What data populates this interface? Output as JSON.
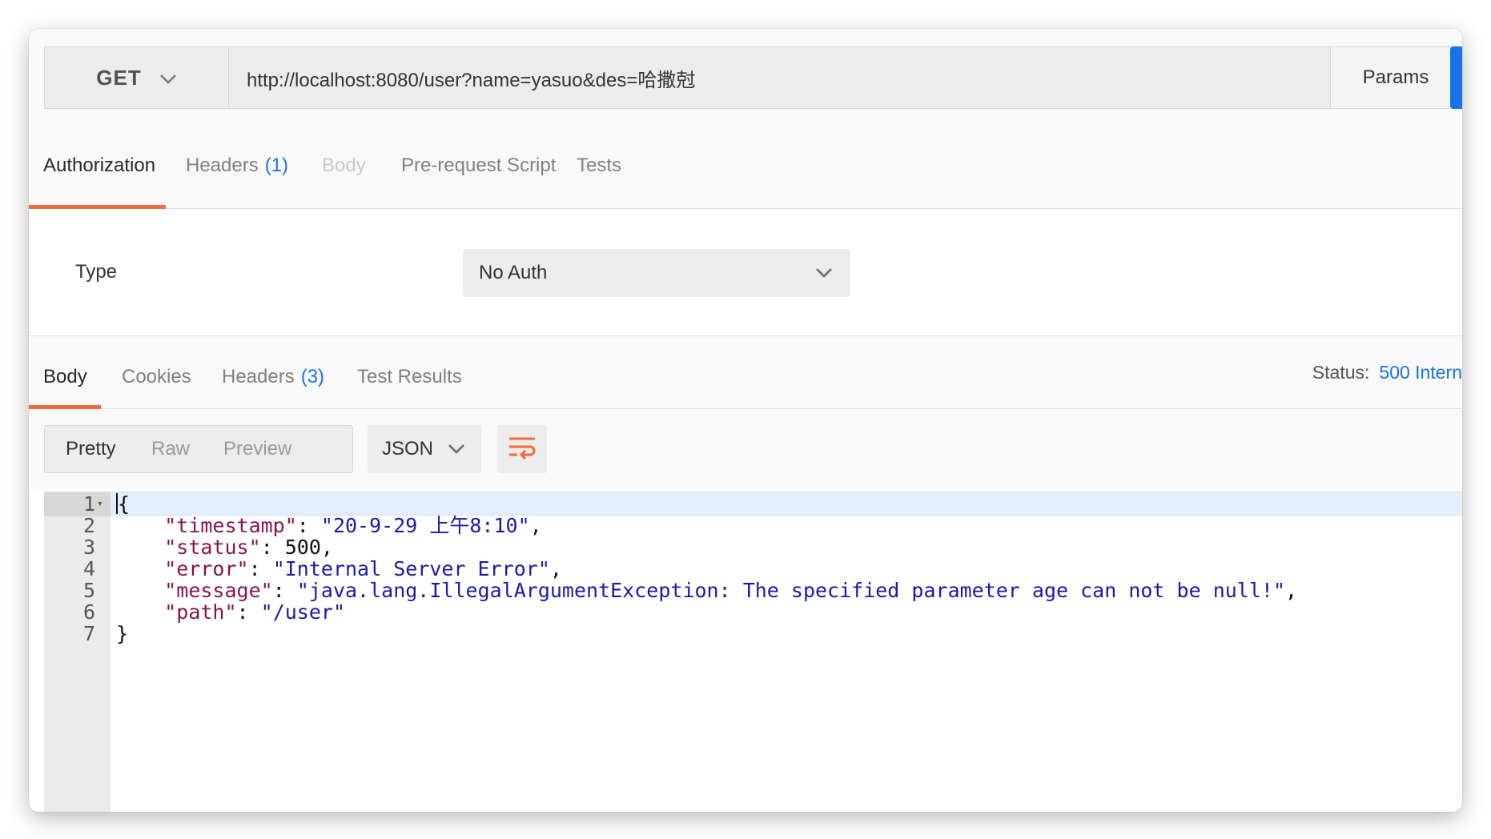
{
  "request": {
    "method": "GET",
    "url": "http://localhost:8080/user?name=yasuo&des=哈撒尅",
    "params_label": "Params"
  },
  "request_tabs": [
    {
      "label": "Authorization",
      "count": ""
    },
    {
      "label": "Headers",
      "count": "(1)"
    },
    {
      "label": "Body",
      "count": ""
    },
    {
      "label": "Pre-request Script",
      "count": ""
    },
    {
      "label": "Tests",
      "count": ""
    }
  ],
  "auth": {
    "type_label": "Type",
    "selected": "No Auth"
  },
  "response_tabs": [
    {
      "label": "Body",
      "count": ""
    },
    {
      "label": "Cookies",
      "count": ""
    },
    {
      "label": "Headers",
      "count": "(3)"
    },
    {
      "label": "Test Results",
      "count": ""
    }
  ],
  "status": {
    "label": "Status:",
    "value": "500 Intern"
  },
  "view_modes": [
    "Pretty",
    "Raw",
    "Preview"
  ],
  "format": "JSON",
  "code_lines": [
    {
      "num": "1",
      "tokens": [
        {
          "t": "{",
          "c": "n"
        }
      ]
    },
    {
      "num": "2",
      "tokens": [
        {
          "t": "    ",
          "c": "n"
        },
        {
          "t": "\"timestamp\"",
          "c": "k"
        },
        {
          "t": ": ",
          "c": "n"
        },
        {
          "t": "\"20-9-29 上午8:10\"",
          "c": "s"
        },
        {
          "t": ",",
          "c": "n"
        }
      ]
    },
    {
      "num": "3",
      "tokens": [
        {
          "t": "    ",
          "c": "n"
        },
        {
          "t": "\"status\"",
          "c": "k"
        },
        {
          "t": ": ",
          "c": "n"
        },
        {
          "t": "500",
          "c": "n"
        },
        {
          "t": ",",
          "c": "n"
        }
      ]
    },
    {
      "num": "4",
      "tokens": [
        {
          "t": "    ",
          "c": "n"
        },
        {
          "t": "\"error\"",
          "c": "k"
        },
        {
          "t": ": ",
          "c": "n"
        },
        {
          "t": "\"Internal Server Error\"",
          "c": "s"
        },
        {
          "t": ",",
          "c": "n"
        }
      ]
    },
    {
      "num": "5",
      "tokens": [
        {
          "t": "    ",
          "c": "n"
        },
        {
          "t": "\"message\"",
          "c": "k"
        },
        {
          "t": ": ",
          "c": "n"
        },
        {
          "t": "\"java.lang.IllegalArgumentException: The specified parameter age can not be null!\"",
          "c": "s"
        },
        {
          "t": ",",
          "c": "n"
        }
      ]
    },
    {
      "num": "6",
      "tokens": [
        {
          "t": "    ",
          "c": "n"
        },
        {
          "t": "\"path\"",
          "c": "k"
        },
        {
          "t": ": ",
          "c": "n"
        },
        {
          "t": "\"/user\"",
          "c": "s"
        }
      ]
    },
    {
      "num": "7",
      "tokens": [
        {
          "t": "}",
          "c": "n"
        }
      ]
    }
  ],
  "colors": {
    "accent_orange": "#f26b3a",
    "accent_blue": "#1a72e8",
    "json_key": "#881350",
    "json_string": "#1a1aa6"
  }
}
